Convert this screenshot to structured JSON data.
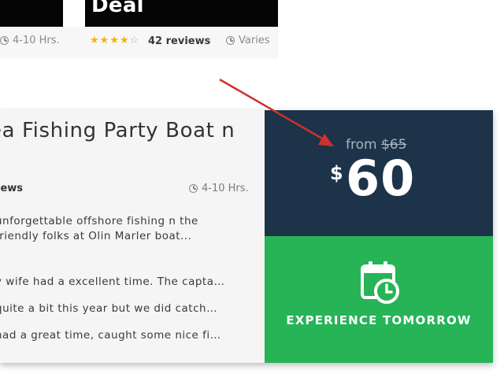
{
  "top_cards": {
    "left": {
      "duration": "4-10 Hrs."
    },
    "right": {
      "title": "Deal",
      "rating": 4,
      "reviews": "42 reviews",
      "duration": "Varies"
    }
  },
  "main_card": {
    "title": "ea Fishing Party Boat n",
    "reviews": "iews",
    "duration": "4-10 Hrs.",
    "description": "unforgettable offshore fishing n the friendly folks at Olin Marler boat...",
    "review_snippets": [
      "y wife had a excellent time. The capta…",
      "quite a bit this year but we did catch…",
      "had a great time, caught some nice fi…"
    ],
    "price": {
      "from_label": "from",
      "old_price": "$65",
      "currency": "$",
      "amount": "60"
    },
    "cta": {
      "label": "EXPERIENCE TOMORROW",
      "icon": "calendar-clock-icon"
    }
  },
  "colors": {
    "price_bg": "#1d3349",
    "cta_bg": "#26b457",
    "star": "#f5b400",
    "arrow": "#d0302a"
  }
}
